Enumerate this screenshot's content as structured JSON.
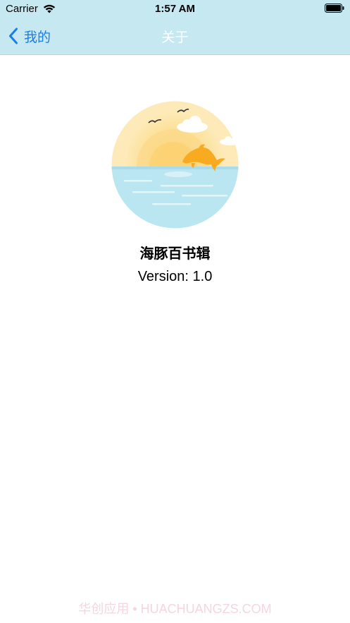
{
  "status_bar": {
    "carrier": "Carrier",
    "time": "1:57 AM",
    "wifi_icon": "wifi-icon",
    "battery_icon": "battery-icon"
  },
  "nav": {
    "back_label": "我的",
    "back_icon": "chevron-left-icon",
    "title": "关于",
    "accent_color": "#1a7ee6",
    "bar_color": "#c6e9f1"
  },
  "app": {
    "logo_icon": "dolphin-sunset-logo",
    "name": "海豚百书辑",
    "version": "Version: 1.0"
  },
  "watermark": "华创应用 • HUACHUANGZS.COM"
}
